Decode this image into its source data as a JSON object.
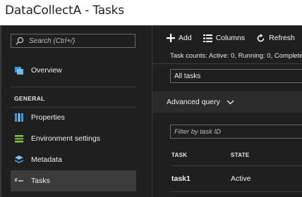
{
  "window": {
    "title": "DataCollectA - Tasks"
  },
  "sidebar": {
    "search_placeholder": "Search (Ctrl+/)",
    "items": [
      {
        "label": "Overview",
        "icon": "overview-icon"
      },
      {
        "label": "Properties",
        "icon": "properties-icon"
      },
      {
        "label": "Environment settings",
        "icon": "environment-settings-icon"
      },
      {
        "label": "Metadata",
        "icon": "metadata-icon"
      },
      {
        "label": "Tasks",
        "icon": "tasks-icon",
        "selected": true
      }
    ],
    "section_label": "GENERAL"
  },
  "toolbar": {
    "add_label": "Add",
    "columns_label": "Columns",
    "refresh_label": "Refresh"
  },
  "main": {
    "task_counts": "Task counts: Active: 0, Running: 0, Complete",
    "task_filter_value": "All tasks",
    "advanced_query_label": "Advanced query",
    "filter_placeholder": "Filter by task ID",
    "table": {
      "columns": [
        "TASK",
        "STATE"
      ],
      "rows": [
        {
          "task": "task1",
          "state": "Active"
        }
      ]
    }
  },
  "colors": {
    "panel_bg": "#1f1f1f",
    "selected_bg": "#3b3b3b",
    "accent_blue": "#3a96dd"
  }
}
